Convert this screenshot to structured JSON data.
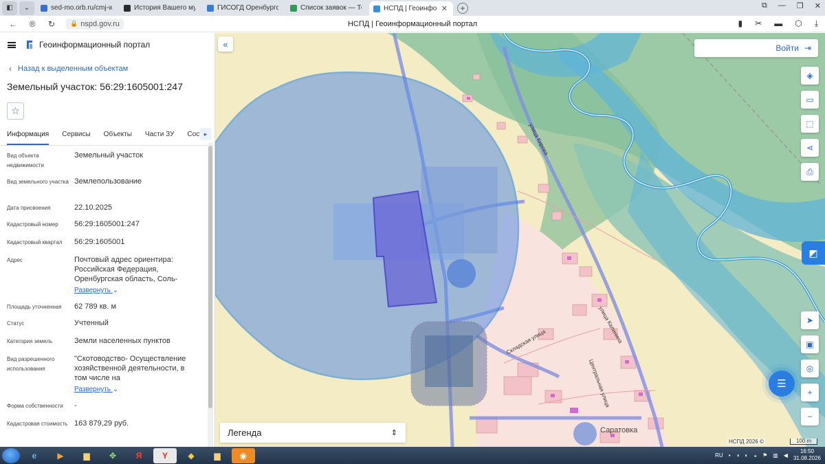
{
  "browser": {
    "tabs": [
      {
        "title": "sed-mo.orb.ru/cmj-web/?",
        "color": "#3a6fd1",
        "active": false
      },
      {
        "title": "История Вашего му",
        "color": "#2b2b2b",
        "active": false
      },
      {
        "title": "ГИСОГД Оренбургской о",
        "color": "#3a7bd5",
        "active": false
      },
      {
        "title": "Список заявок — ТехноК",
        "color": "#2e9b57",
        "active": false
      },
      {
        "title": "НСПД | Геоинформацио",
        "color": "#3a8fd6",
        "active": true
      }
    ],
    "new_tab": "+",
    "url": "nspd.gov.ru",
    "page_title": "НСПД | Геоинформационный портал"
  },
  "panel": {
    "brand": "Геоинформационный портал",
    "back_label": "Назад к выделенным объектам",
    "object_title": "Земельный участок: 56:29:1605001:247",
    "tabs": [
      "Информация",
      "Сервисы",
      "Объекты",
      "Части ЗУ",
      "Состав"
    ],
    "attributes": [
      {
        "key": "Вид объекта недвижимости",
        "value": "Земельный участок"
      },
      {
        "key": "Вид земельного участка",
        "value": "Землепользование"
      },
      {
        "key": "Дата присвоения",
        "value": "22.10.2025"
      },
      {
        "key": "Кадастровый номер",
        "value": "56:29:1605001:247"
      },
      {
        "key": "Кадастровый квартал",
        "value": "56:29:1605001"
      },
      {
        "key": "Адрес",
        "value": "Почтовый адрес ориентира: Российская Федерация, Оренбургская область, Соль-",
        "more": "Развернуть"
      },
      {
        "key": "Площадь уточненная",
        "value": "62 789 кв. м"
      },
      {
        "key": "Статус",
        "value": "Учтенный"
      },
      {
        "key": "Категория земель",
        "value": "Земли населенных пунктов"
      },
      {
        "key": "Вид разрешенного использования",
        "value": "\"Скотоводство- Осуществление хозяйственной деятельности, в том числе на сельскохозяйственных",
        "more": "Развернуть"
      },
      {
        "key": "Форма собственности",
        "value": "-"
      },
      {
        "key": "Кадастровая стоимость",
        "value": "163 879,29 руб."
      }
    ]
  },
  "map": {
    "login_label": "Войти",
    "legend_label": "Легенда",
    "copyright": "НСПД 2026 ©",
    "scale_label": "100 m",
    "street_labels": [
      "улица Кирова",
      "Складская улица",
      "улица Калинина",
      "Центральная улица"
    ],
    "place_label": "Саратовка"
  },
  "taskbar": {
    "lang": "RU",
    "time": "16:50",
    "date": "31.08.2026"
  }
}
